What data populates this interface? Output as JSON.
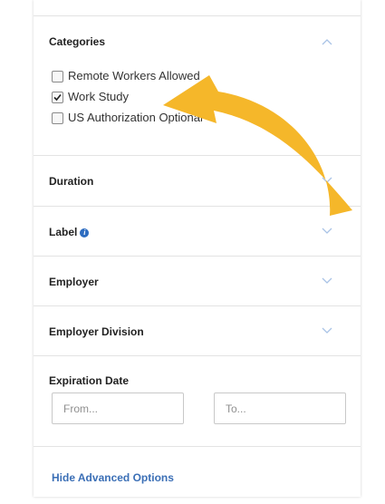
{
  "filters": {
    "categories": {
      "title": "Categories",
      "options": [
        {
          "label": "Remote Workers Allowed",
          "checked": false
        },
        {
          "label": "Work Study",
          "checked": true
        },
        {
          "label": "US Authorization Optional",
          "checked": false
        }
      ]
    },
    "duration": {
      "title": "Duration"
    },
    "label": {
      "title": "Label",
      "info_icon": "i"
    },
    "employer": {
      "title": "Employer"
    },
    "employer_division": {
      "title": "Employer Division"
    },
    "expiration_date": {
      "title": "Expiration Date",
      "from_placeholder": "From...",
      "to_placeholder": "To..."
    },
    "hide_advanced_label": "Hide Advanced Options"
  },
  "colors": {
    "chevron": "#a9c3e6",
    "link": "#3b6fb6",
    "arrow": "#f5b72a",
    "info_icon": "#2d6cc0"
  }
}
